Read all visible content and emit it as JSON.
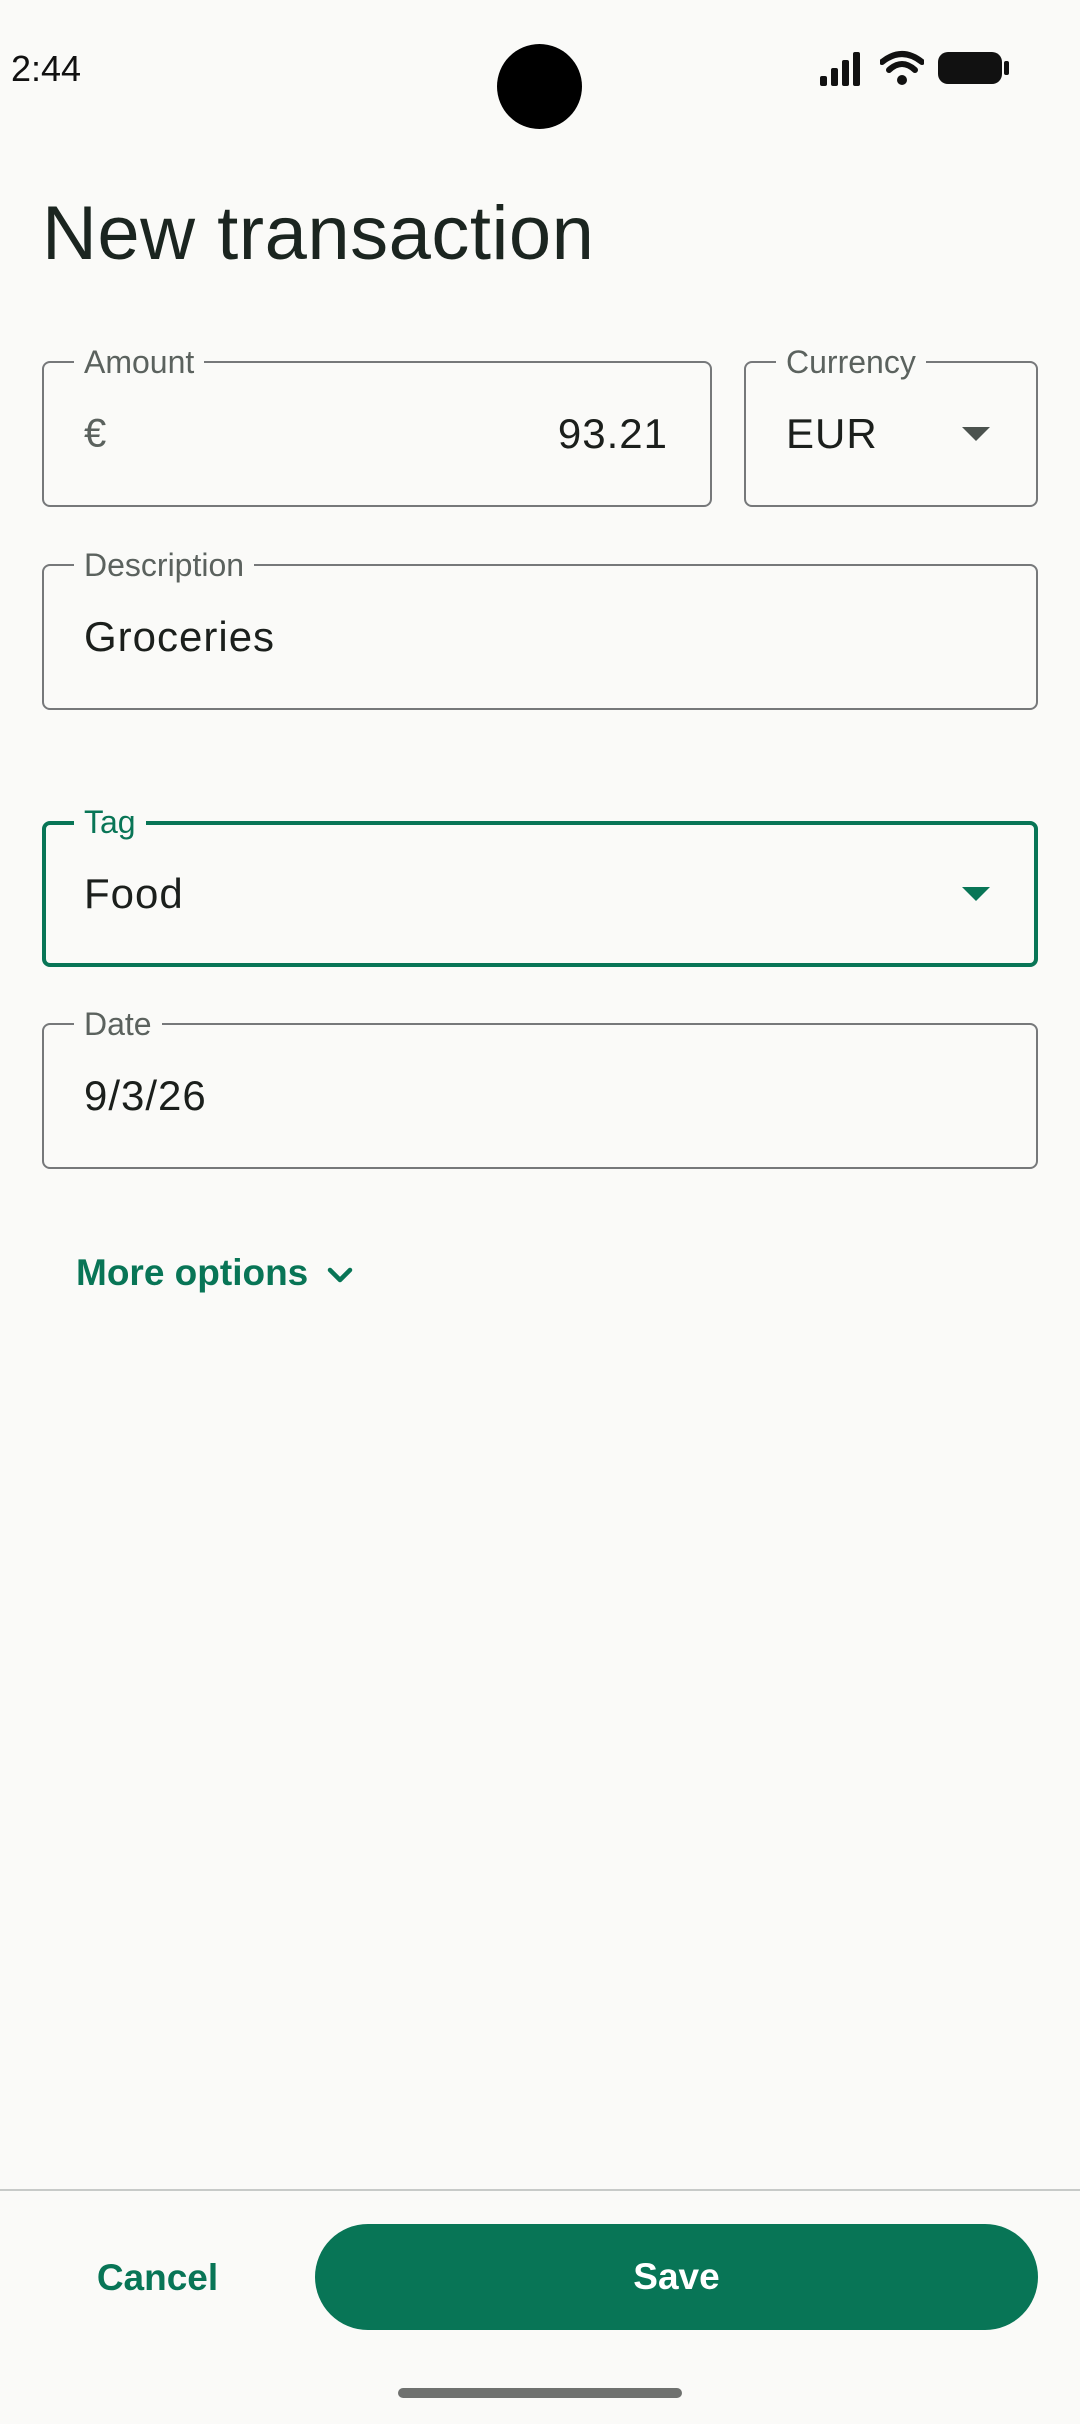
{
  "status_bar": {
    "time": "2:44",
    "icons": [
      "signal-icon",
      "wifi-icon",
      "battery-icon"
    ]
  },
  "page": {
    "title": "New transaction"
  },
  "form": {
    "amount": {
      "label": "Amount",
      "prefix": "€",
      "value": "93.21"
    },
    "currency": {
      "label": "Currency",
      "value": "EUR"
    },
    "description": {
      "label": "Description",
      "value": "Groceries"
    },
    "tag": {
      "label": "Tag",
      "value": "Food",
      "focused": true
    },
    "date": {
      "label": "Date",
      "value": "9/3/26"
    },
    "more_options_label": "More options"
  },
  "actions": {
    "cancel_label": "Cancel",
    "save_label": "Save"
  },
  "colors": {
    "accent": "#087556",
    "background": "#fafaf8",
    "outline": "#76787a"
  }
}
